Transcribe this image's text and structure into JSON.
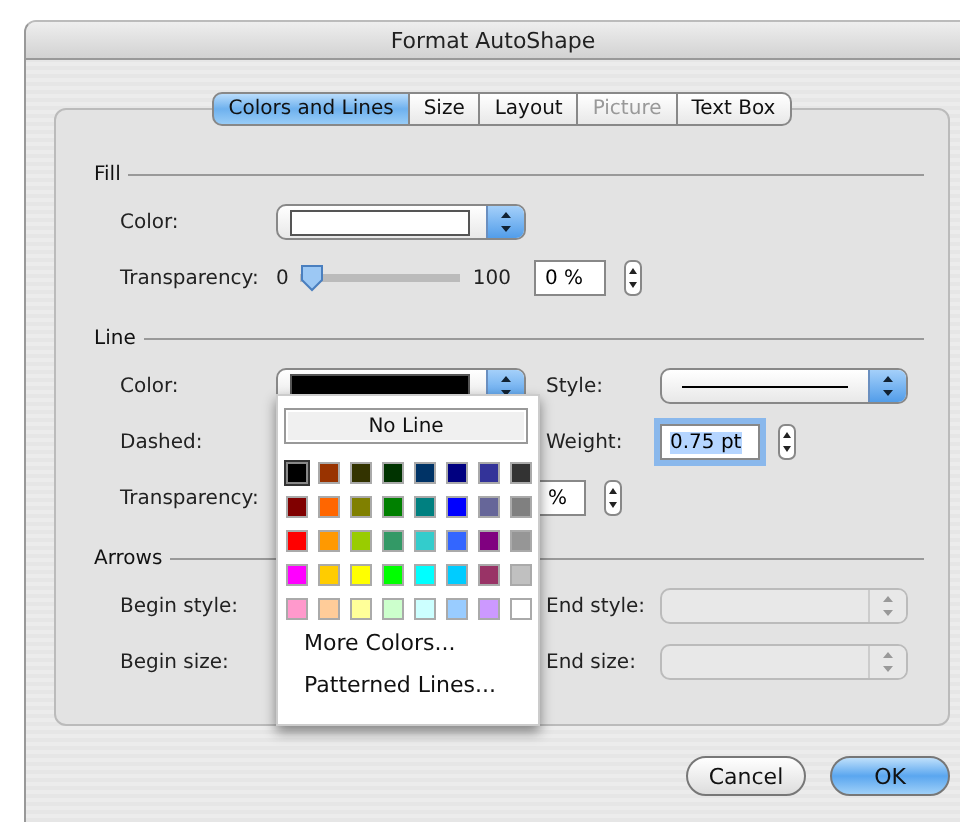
{
  "window": {
    "title": "Format AutoShape"
  },
  "tabs": [
    {
      "label": "Colors and Lines",
      "selected": true,
      "disabled": false
    },
    {
      "label": "Size",
      "selected": false,
      "disabled": false
    },
    {
      "label": "Layout",
      "selected": false,
      "disabled": false
    },
    {
      "label": "Picture",
      "selected": false,
      "disabled": true
    },
    {
      "label": "Text Box",
      "selected": false,
      "disabled": false
    }
  ],
  "fill": {
    "title": "Fill",
    "color": {
      "label": "Color:",
      "color": "#ffffff"
    },
    "transparency": {
      "label": "Transparency:",
      "min": "0",
      "max": "100",
      "level": 0,
      "value": "0 %"
    }
  },
  "line": {
    "title": "Line",
    "color": {
      "label": "Color:",
      "color": "#000000"
    },
    "style": {
      "label": "Style:"
    },
    "dashed": {
      "label": "Dashed:"
    },
    "weight": {
      "label": "Weight:",
      "value": "0.75 pt",
      "focused": true
    },
    "transparency": {
      "label": "Transparency:",
      "value": "%"
    }
  },
  "arrows": {
    "title": "Arrows",
    "begin_style": {
      "label": "Begin style:"
    },
    "end_style": {
      "label": "End style:",
      "disabled": true
    },
    "begin_size": {
      "label": "Begin size:"
    },
    "end_size": {
      "label": "End size:",
      "disabled": true
    }
  },
  "popup": {
    "button": "No Line",
    "swatches": [
      {
        "color": "#000000",
        "selected": true
      },
      {
        "color": "#993300",
        "selected": false
      },
      {
        "color": "#333300",
        "selected": false
      },
      {
        "color": "#003300",
        "selected": false
      },
      {
        "color": "#003366",
        "selected": false
      },
      {
        "color": "#000080",
        "selected": false
      },
      {
        "color": "#333399",
        "selected": false
      },
      {
        "color": "#333333",
        "selected": false
      },
      {
        "color": "#800000",
        "selected": false
      },
      {
        "color": "#ff6600",
        "selected": false
      },
      {
        "color": "#808000",
        "selected": false
      },
      {
        "color": "#008000",
        "selected": false
      },
      {
        "color": "#008080",
        "selected": false
      },
      {
        "color": "#0000ff",
        "selected": false
      },
      {
        "color": "#666699",
        "selected": false
      },
      {
        "color": "#808080",
        "selected": false
      },
      {
        "color": "#ff0000",
        "selected": false
      },
      {
        "color": "#ff9900",
        "selected": false
      },
      {
        "color": "#99cc00",
        "selected": false
      },
      {
        "color": "#339966",
        "selected": false
      },
      {
        "color": "#33cccc",
        "selected": false
      },
      {
        "color": "#3366ff",
        "selected": false
      },
      {
        "color": "#800080",
        "selected": false
      },
      {
        "color": "#969696",
        "selected": false
      },
      {
        "color": "#ff00ff",
        "selected": false
      },
      {
        "color": "#ffcc00",
        "selected": false
      },
      {
        "color": "#ffff00",
        "selected": false
      },
      {
        "color": "#00ff00",
        "selected": false
      },
      {
        "color": "#00ffff",
        "selected": false
      },
      {
        "color": "#00ccff",
        "selected": false
      },
      {
        "color": "#993366",
        "selected": false
      },
      {
        "color": "#c0c0c0",
        "selected": false
      },
      {
        "color": "#ff99cc",
        "selected": false
      },
      {
        "color": "#ffcc99",
        "selected": false
      },
      {
        "color": "#ffff99",
        "selected": false
      },
      {
        "color": "#ccffcc",
        "selected": false
      },
      {
        "color": "#ccffff",
        "selected": false
      },
      {
        "color": "#99ccff",
        "selected": false
      },
      {
        "color": "#cc99ff",
        "selected": false
      },
      {
        "color": "#ffffff",
        "selected": false
      }
    ],
    "items": [
      "More Colors...",
      "Patterned Lines..."
    ]
  },
  "buttons": [
    {
      "label": "Cancel",
      "default": false
    },
    {
      "label": "OK",
      "default": true
    }
  ]
}
